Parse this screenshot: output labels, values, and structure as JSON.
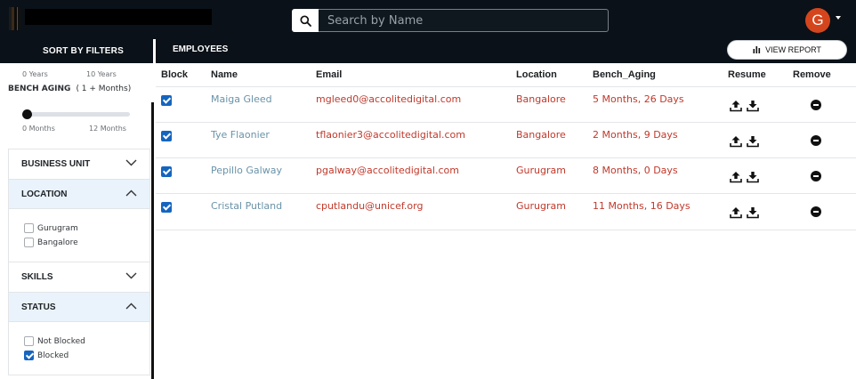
{
  "header": {
    "search_placeholder": "Search by Name",
    "avatar_initial": "G"
  },
  "subheader": {
    "sort_title": "SORT BY FILTERS",
    "employees_title": "EMPLOYEES",
    "view_report_label": "VIEW REPORT"
  },
  "filters": {
    "years_min": "0 Years",
    "years_max": "10 Years",
    "bench_aging_label": "BENCH AGING",
    "bench_aging_sub": "( 1 + Months)",
    "months_min": "0 Months",
    "months_max": "12 Months",
    "slider_value_fraction": 0,
    "sections": {
      "business_unit": "BUSINESS UNIT",
      "location": "LOCATION",
      "skills": "SKILLS",
      "status": "STATUS"
    },
    "location_options": [
      {
        "label": "Gurugram",
        "checked": false
      },
      {
        "label": "Bangalore",
        "checked": false
      }
    ],
    "status_options": [
      {
        "label": "Not Blocked",
        "checked": false
      },
      {
        "label": "Blocked",
        "checked": true
      }
    ]
  },
  "table": {
    "columns": [
      "Block",
      "Name",
      "Email",
      "Location",
      "Bench_Aging",
      "Resume",
      "Remove"
    ],
    "rows": [
      {
        "blocked": true,
        "name": "Maiga Gleed",
        "email": "mgleed0@accolitedigital.com",
        "location": "Bangalore",
        "bench_aging": "5 Months, 26 Days"
      },
      {
        "blocked": true,
        "name": "Tye Flaonier",
        "email": "tflaonier3@accolitedigital.com",
        "location": "Bangalore",
        "bench_aging": "2 Months, 9 Days"
      },
      {
        "blocked": true,
        "name": "Pepillo Galway",
        "email": "pgalway@accolitedigital.com",
        "location": "Gurugram",
        "bench_aging": "8 Months, 0 Days"
      },
      {
        "blocked": true,
        "name": "Cristal Putland",
        "email": "cputlandu@unicef.org",
        "location": "Gurugram",
        "bench_aging": "11 Months, 16 Days"
      }
    ]
  },
  "colors": {
    "header_bg": "#0a1118",
    "accent_blue": "#1565c0",
    "red_text": "#c0392b",
    "name_text": "#6a93a8",
    "avatar_bg": "#d5451d"
  },
  "icons": [
    "search-icon",
    "chevron-down-icon",
    "chevron-up-icon",
    "bar-chart-icon",
    "upload-icon",
    "download-icon",
    "remove-icon"
  ]
}
